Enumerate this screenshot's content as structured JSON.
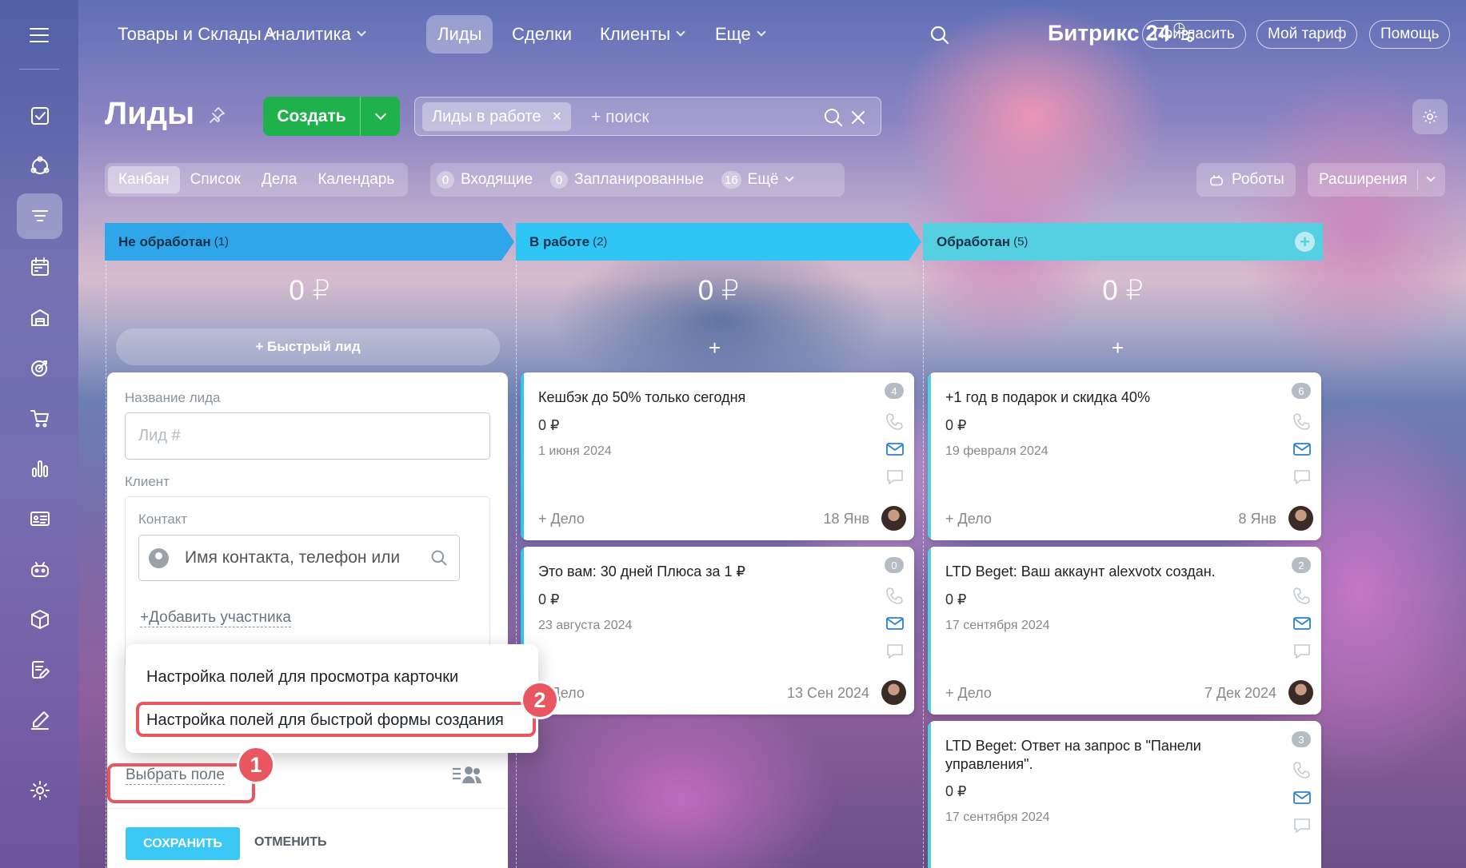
{
  "nav": {
    "items": [
      {
        "label": "Товары и Склады",
        "dropdown": true
      },
      {
        "label": "Аналитика",
        "dropdown": true
      },
      {
        "label": "Лиды",
        "active": true
      },
      {
        "label": "Сделки"
      },
      {
        "label": "Клиенты",
        "dropdown": true
      },
      {
        "label": "Еще",
        "dropdown": true
      }
    ],
    "logo": "Битрикс",
    "logo_num": "24",
    "invite": "Пригласить",
    "tariff": "Мой тариф",
    "help": "Помощь"
  },
  "page": {
    "title": "Лиды",
    "create": "Создать",
    "filter_chip": "Лиды в работе",
    "filter_chip_close": "×",
    "search_placeholder": "+ поиск",
    "view_tabs": [
      "Канбан",
      "Список",
      "Дела",
      "Календарь"
    ],
    "counters": [
      {
        "n": "0",
        "label": "Входящие"
      },
      {
        "n": "0",
        "label": "Запланированные"
      },
      {
        "n": "16",
        "label": "Ещё"
      }
    ],
    "robots": "Роботы",
    "extensions": "Расширения"
  },
  "columns": [
    {
      "name": "Не обработан",
      "count": "(1)",
      "sum": "0 ₽",
      "quick": "+  Быстрый лид",
      "color": "#2fa6ea"
    },
    {
      "name": "В работе",
      "count": "(2)",
      "sum": "0 ₽",
      "plus": "+",
      "color": "#2fc6f6"
    },
    {
      "name": "Обработан",
      "count": "(5)",
      "sum": "0 ₽",
      "plus": "+",
      "color": "#55d0e0"
    }
  ],
  "cards": {
    "c1": {
      "title": "Кешбэк до 50% только сегодня",
      "amount": "0 ₽",
      "date": "1 июня 2024",
      "deal": "+ Дело",
      "when": "18 Янв",
      "badge": "4"
    },
    "c2": {
      "title": "Это вам: 30 дней Плюса за 1 ₽",
      "amount": "0 ₽",
      "date": "23 августа 2024",
      "deal": "+ Дело",
      "when": "13 Сен 2024",
      "badge": "0"
    },
    "c3": {
      "title": "+1 год в подарок и скидка 40%",
      "amount": "0 ₽",
      "date": "19 февраля 2024",
      "deal": "+ Дело",
      "when": "8 Янв",
      "badge": "6"
    },
    "c4": {
      "title": "LTD Beget: Ваш аккаунт alexvotx создан.",
      "amount": "0 ₽",
      "date": "17 сентября 2024",
      "deal": "+ Дело",
      "when": "7 Дек 2024",
      "badge": "2"
    },
    "c5": {
      "title": "LTD Beget: Ответ на запрос в \"Панели управления\".",
      "amount": "0 ₽",
      "date": "17 сентября 2024",
      "badge": "3"
    }
  },
  "form": {
    "name_label": "Название лида",
    "name_placeholder": "Лид #",
    "client_label": "Клиент",
    "contact_label": "Контакт",
    "contact_placeholder": "Имя контакта, телефон или",
    "add_participant": "+Добавить участника",
    "choose_field": "Выбрать поле",
    "save": "СОХРАНИТЬ",
    "cancel": "ОТМЕНИТЬ"
  },
  "menu": {
    "item1": "Настройка полей для просмотра карточки",
    "item2": "Настройка полей для быстрой формы создания"
  },
  "annotations": {
    "step1": "1",
    "step2": "2",
    "color": "#e85660"
  }
}
